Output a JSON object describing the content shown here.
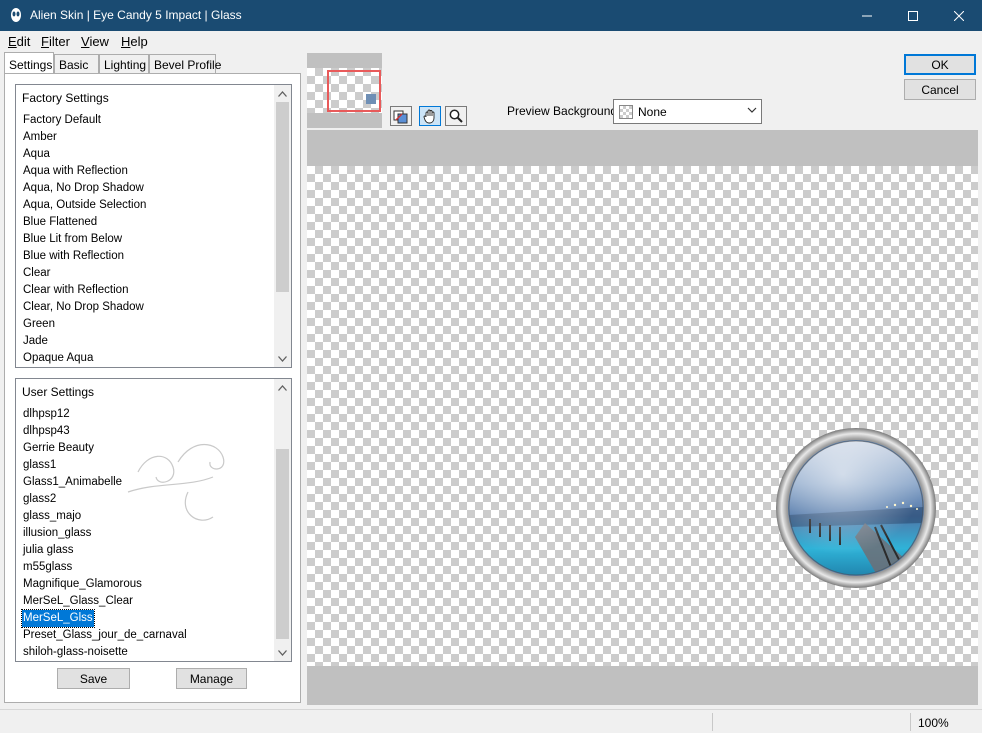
{
  "window": {
    "title": "Alien Skin | Eye Candy 5 Impact | Glass"
  },
  "menu": [
    {
      "u": "E",
      "rest": "dit"
    },
    {
      "u": "F",
      "rest": "ilter"
    },
    {
      "u": "V",
      "rest": "iew"
    },
    {
      "u": "H",
      "rest": "elp"
    }
  ],
  "tabs": [
    "Settings",
    "Basic",
    "Lighting",
    "Bevel Profile"
  ],
  "factory": {
    "header": "Factory Settings",
    "items": [
      "Factory Default",
      "Amber",
      "Aqua",
      "Aqua with Reflection",
      "Aqua, No Drop Shadow",
      "Aqua, Outside Selection",
      "Blue Flattened",
      "Blue Lit from Below",
      "Blue with Reflection",
      "Clear",
      "Clear with Reflection",
      "Clear, No Drop Shadow",
      "Green",
      "Jade",
      "Opaque Aqua"
    ]
  },
  "user": {
    "header": "User Settings",
    "items": [
      "dlhpsp12",
      "dlhpsp43",
      "Gerrie Beauty",
      "glass1",
      "Glass1_Animabelle",
      "glass2",
      "glass_majo",
      "illusion_glass",
      "julia glass",
      "m55glass",
      "Magnifique_Glamorous",
      "MerSeL_Glass_Clear",
      "MerSeL_Glss",
      "Preset_Glass_jour_de_carnaval",
      "shiloh-glass-noisette"
    ],
    "selected_index": 12
  },
  "buttons": {
    "save": "Save",
    "manage": "Manage",
    "ok": "OK",
    "cancel": "Cancel"
  },
  "preview_background": {
    "label": "Preview Background:",
    "value": "None"
  },
  "status": {
    "zoom": "100%"
  },
  "colors": {
    "titlebar": "#1a4b72",
    "selection": "#0078d7",
    "frame_gray": "#c0c0c0"
  }
}
